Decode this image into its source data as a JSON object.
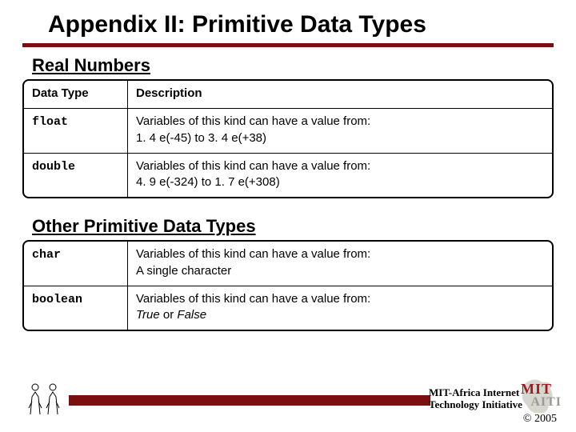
{
  "title": "Appendix II: Primitive Data Types",
  "sections": {
    "real": {
      "heading": "Real Numbers",
      "headers": {
        "type": "Data Type",
        "desc": "Description"
      },
      "rows": [
        {
          "type": "float",
          "desc_l1": "Variables of this kind can have a value from:",
          "desc_l2": "1. 4 e(-45) to 3. 4 e(+38)"
        },
        {
          "type": "double",
          "desc_l1": "Variables of this kind can have a value from:",
          "desc_l2": "4. 9 e(-324) to 1. 7 e(+308)"
        }
      ]
    },
    "other": {
      "heading": "Other Primitive Data Types",
      "rows": [
        {
          "type": "char",
          "desc_l1": "Variables of this kind can have a value from:",
          "desc_l2": "A single character"
        },
        {
          "type": "boolean",
          "desc_l1": "Variables of this kind can have a value from:",
          "desc_l2_a": "True",
          "desc_l2_b": " or ",
          "desc_l2_c": "False"
        }
      ]
    }
  },
  "footer": {
    "org": "MIT-Africa Internet Technology Initiative",
    "mit": "MIT",
    "aiti": "AITI",
    "copyright": "© 2005"
  }
}
